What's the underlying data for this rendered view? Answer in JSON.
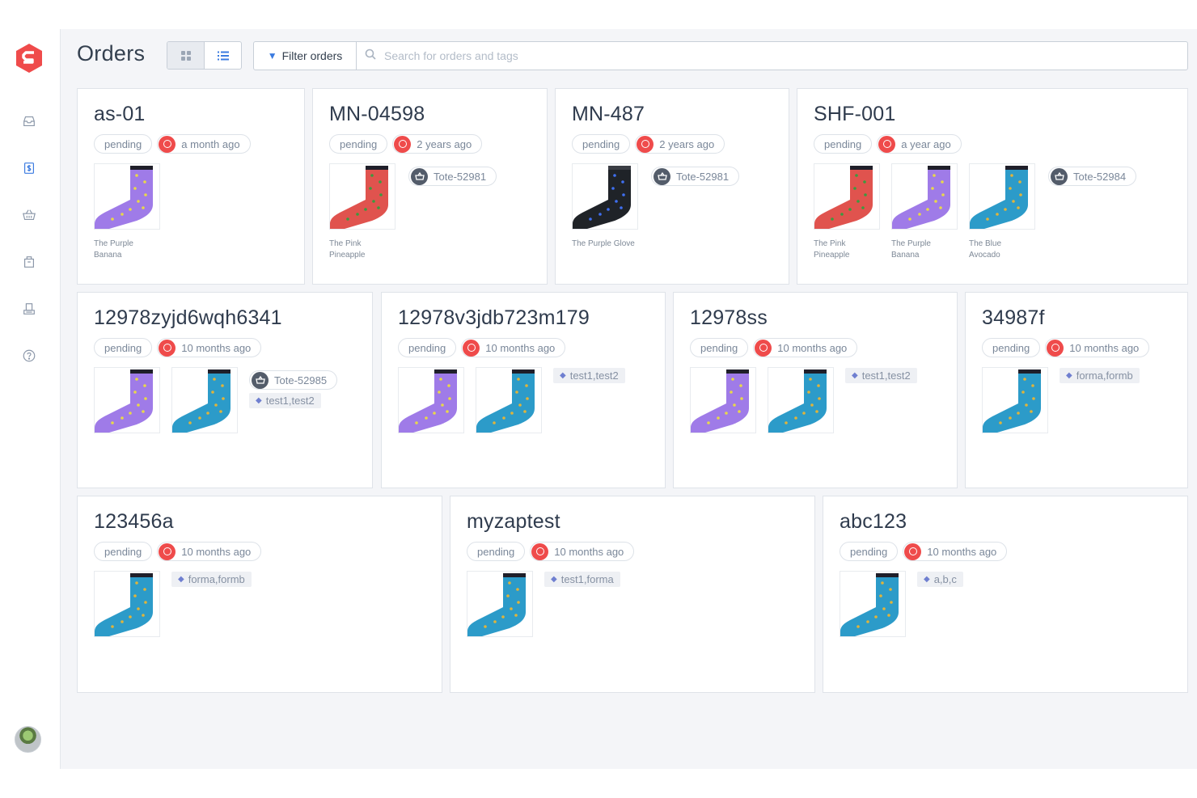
{
  "sidebar": {
    "nav": [
      {
        "icon": "inbox-icon"
      },
      {
        "icon": "dollar-icon"
      },
      {
        "icon": "basket-icon"
      },
      {
        "icon": "package-icon"
      },
      {
        "icon": "printer-icon"
      },
      {
        "icon": "help-icon"
      }
    ],
    "active_index": 1
  },
  "header": {
    "title": "Orders",
    "filter_label": "Filter orders",
    "search_placeholder": "Search for orders and tags",
    "search_value": ""
  },
  "colors": {
    "brand": "#ef4b4b",
    "accent": "#3b7be0",
    "tag_icon": "#6f7fd0"
  },
  "orders": [
    {
      "id": "as-01",
      "status": "pending",
      "time": "a month ago",
      "items": [
        {
          "name": "The Purple\nBanana",
          "color": "purple"
        }
      ],
      "tote": "",
      "tag": ""
    },
    {
      "id": "MN-04598",
      "status": "pending",
      "time": "2 years ago",
      "items": [
        {
          "name": "The Pink\nPineapple",
          "color": "pink"
        }
      ],
      "tote": "Tote-52981",
      "tag": ""
    },
    {
      "id": "MN-487",
      "status": "pending",
      "time": "2 years ago",
      "items": [
        {
          "name": "The Purple Glove",
          "color": "black"
        }
      ],
      "tote": "Tote-52981",
      "tag": ""
    },
    {
      "id": "SHF-001",
      "status": "pending",
      "time": "a year ago",
      "items": [
        {
          "name": "The Pink\nPineapple",
          "color": "pink"
        },
        {
          "name": "The Purple\nBanana",
          "color": "purple"
        },
        {
          "name": "The Blue\nAvocado",
          "color": "blue"
        }
      ],
      "tote": "Tote-52984",
      "tag": ""
    },
    {
      "id": "12978zyjd6wqh6341",
      "status": "pending",
      "time": "10 months ago",
      "items": [
        {
          "name": "",
          "color": "purple"
        },
        {
          "name": "",
          "color": "blue"
        }
      ],
      "tote": "Tote-52985",
      "tag": "test1,test2"
    },
    {
      "id": "12978v3jdb723m179",
      "status": "pending",
      "time": "10 months ago",
      "items": [
        {
          "name": "",
          "color": "purple"
        },
        {
          "name": "",
          "color": "blue"
        }
      ],
      "tote": "",
      "tag": "test1,test2"
    },
    {
      "id": "12978ss",
      "status": "pending",
      "time": "10 months ago",
      "items": [
        {
          "name": "",
          "color": "purple"
        },
        {
          "name": "",
          "color": "blue"
        }
      ],
      "tote": "",
      "tag": "test1,test2"
    },
    {
      "id": "34987f",
      "status": "pending",
      "time": "10 months ago",
      "items": [
        {
          "name": "",
          "color": "blue"
        }
      ],
      "tote": "",
      "tag": "forma,formb"
    },
    {
      "id": "123456a",
      "status": "pending",
      "time": "10 months ago",
      "items": [
        {
          "name": "",
          "color": "blue"
        }
      ],
      "tote": "",
      "tag": "forma,formb"
    },
    {
      "id": "myzaptest",
      "status": "pending",
      "time": "10 months ago",
      "items": [
        {
          "name": "",
          "color": "blue"
        }
      ],
      "tote": "",
      "tag": "test1,forma"
    },
    {
      "id": "abc123",
      "status": "pending",
      "time": "10 months ago",
      "items": [
        {
          "name": "",
          "color": "blue"
        }
      ],
      "tote": "",
      "tag": "a,b,c"
    }
  ]
}
